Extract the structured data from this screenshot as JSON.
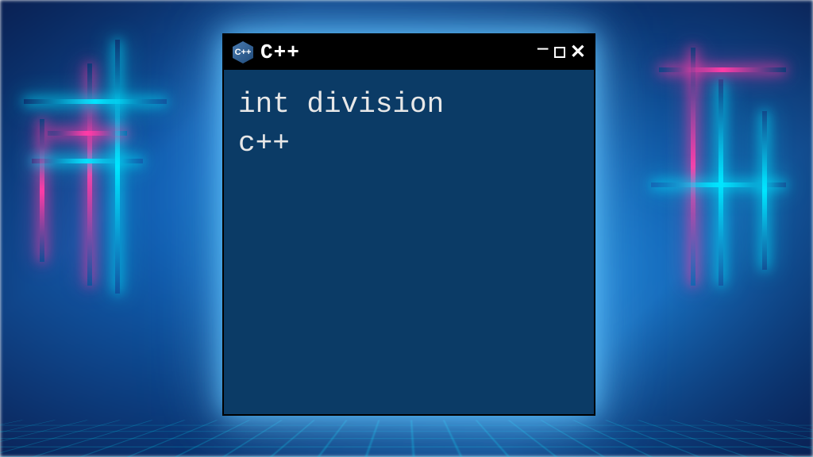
{
  "window": {
    "title": "C++",
    "icon_label": "C++",
    "controls": {
      "minimize": "−",
      "maximize": "□",
      "close": "×"
    }
  },
  "content": {
    "line1": "int division",
    "line2": "c++"
  },
  "colors": {
    "window_bg": "#0b3b66",
    "titlebar_bg": "#000000",
    "text": "#e8e8e8",
    "neon_cyan": "#00e5ff",
    "neon_pink": "#ff3ba7"
  }
}
